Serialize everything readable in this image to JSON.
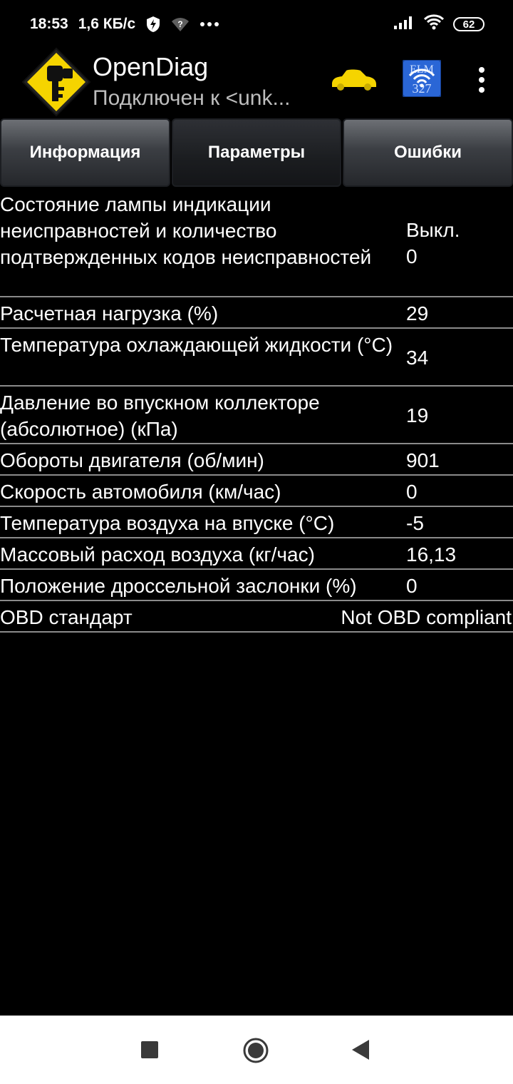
{
  "status_bar": {
    "time": "18:53",
    "network_speed": "1,6 КБ/с",
    "vpn_icon": "shield-bolt-icon",
    "wifi_question_icon": "wifi-question-icon",
    "more_icon": "ellipsis-icon",
    "signal_icon": "signal-icon",
    "wifi_icon": "wifi-icon",
    "battery": "62"
  },
  "app_bar": {
    "title": "OpenDiag",
    "subtitle": "Подключен к <unk...",
    "logo_icon": "key-sign-icon",
    "car_icon": "car-icon",
    "adapter_icon": "elm327-wifi-icon",
    "menu_icon": "overflow-menu-icon",
    "accent_color": "#f5d400"
  },
  "tabs": [
    {
      "label": "Информация",
      "active": false
    },
    {
      "label": "Параметры",
      "active": true
    },
    {
      "label": "Ошибки",
      "active": false
    }
  ],
  "params": [
    {
      "name": "Состояние лампы индикации неисправностей и количество подтвержденных кодов неисправностей",
      "value": "Выкл.\n0"
    },
    {
      "name": "Расчетная нагрузка (%)",
      "value": "29"
    },
    {
      "name": "Температура охлаждающей жидкости (°С)",
      "value": "34"
    },
    {
      "name": "Давление во впускном коллекторе (абсолютное) (кПа)",
      "value": "19"
    },
    {
      "name": "Обороты двигателя (об/мин)",
      "value": "901"
    },
    {
      "name": "Скорость автомобиля (км/час)",
      "value": "0"
    },
    {
      "name": "Температура воздуха на впуске (°С)",
      "value": "-5"
    },
    {
      "name": "Массовый расход воздуха (кг/час)",
      "value": "16,13"
    },
    {
      "name": "Положение дроссельной заслонки (%)",
      "value": "0"
    },
    {
      "name": "OBD стандарт",
      "value": "Not OBD compliant"
    }
  ],
  "nav_bar": {
    "recents_icon": "square-icon",
    "home_icon": "circle-icon",
    "back_icon": "triangle-back-icon"
  }
}
